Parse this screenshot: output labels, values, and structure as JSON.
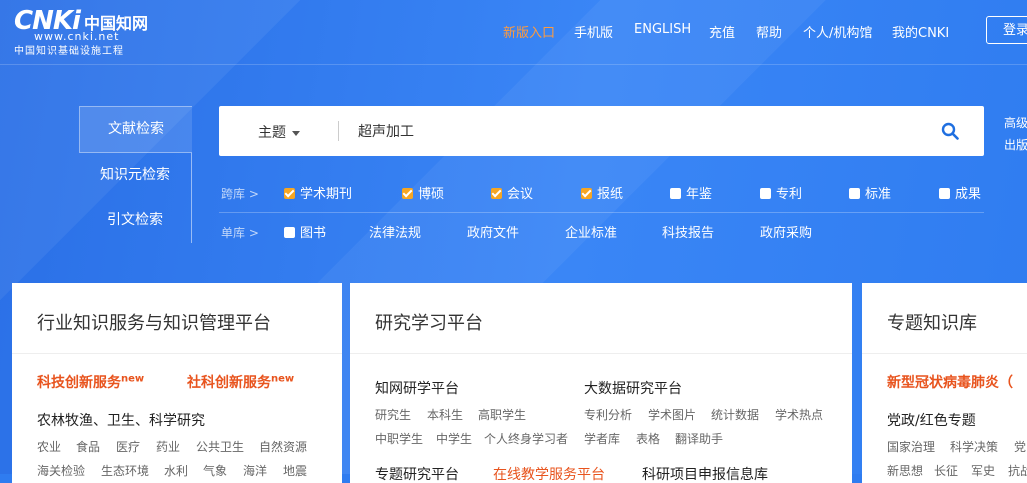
{
  "brand": {
    "logo_text": "CNKi",
    "cn_name": "中国知网",
    "url": "www.cnki.net",
    "sub": "中国知识基础设施工程"
  },
  "nav": {
    "items": [
      "新版入口",
      "手机版",
      "ENGLISH",
      "充值",
      "帮助",
      "个人/机构馆",
      "我的CNKI"
    ],
    "login": "登录"
  },
  "side_tabs": [
    "文献检索",
    "知识元检索",
    "引文检索"
  ],
  "search": {
    "field": "主题",
    "query": "超声加工",
    "advanced_line1": "高级",
    "advanced_line2": "出版"
  },
  "cross_db": {
    "label": "跨库 >",
    "options": [
      {
        "label": "学术期刊",
        "checked": true
      },
      {
        "label": "博硕",
        "checked": true
      },
      {
        "label": "会议",
        "checked": true
      },
      {
        "label": "报纸",
        "checked": true
      },
      {
        "label": "年鉴",
        "checked": false
      },
      {
        "label": "专利",
        "checked": false
      },
      {
        "label": "标准",
        "checked": false
      },
      {
        "label": "成果",
        "checked": false
      }
    ]
  },
  "single_db": {
    "label": "单库 >",
    "checkbox_option": "图书",
    "links": [
      "法律法规",
      "政府文件",
      "企业标准",
      "科技报告",
      "政府采购"
    ]
  },
  "cards": {
    "industry": {
      "title": "行业知识服务与知识管理平台",
      "red1": "科技创新服务",
      "red2": "社科创新服务",
      "sup": "new",
      "heading": "农林牧渔、卫生、科学研究",
      "row1": [
        "农业",
        "食品",
        "医疗",
        "药业",
        "公共卫生",
        "自然资源"
      ],
      "row2": [
        "海关检验",
        "生态环境",
        "水利",
        "气象",
        "海洋",
        "地震"
      ]
    },
    "research": {
      "title": "研究学习平台",
      "col1_head": "知网研学平台",
      "col1_row1": [
        "研究生",
        "本科生",
        "高职学生"
      ],
      "col1_row2": [
        "中职学生",
        "中学生",
        "个人终身学习者"
      ],
      "col2_head": "大数据研究平台",
      "col2_row1": [
        "专利分析",
        "学术图片",
        "统计数据",
        "学术热点"
      ],
      "col2_row2": [
        "学者库",
        "表格",
        "翻译助手"
      ],
      "bottom1": "专题研究平台",
      "bottom2": "在线教学服务平台",
      "bottom3": "科研项目申报信息库"
    },
    "topic": {
      "title": "专题知识库",
      "red": "新型冠状病毒肺炎（",
      "heading": "党政/红色专题",
      "row1": [
        "国家治理",
        "科学决策",
        "党"
      ],
      "row2": [
        "新思想",
        "长征",
        "军史",
        "抗战"
      ]
    }
  },
  "colors": {
    "accent_orange": "#ff9b3d",
    "checkbox_on": "#f6a623",
    "red_link": "#e8541e",
    "bg_blue": "#2f7cf0"
  }
}
